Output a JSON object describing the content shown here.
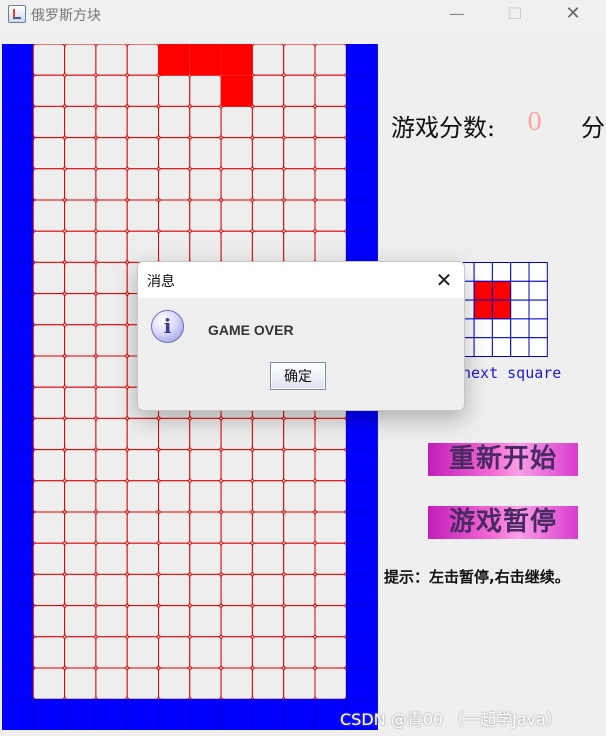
{
  "window": {
    "title": "俄罗斯方块",
    "minimize_glyph": "—",
    "maximize_glyph": "☐",
    "close_glyph": "✕"
  },
  "colors": {
    "wall": "#0000ff",
    "cell_border": "#e00000",
    "cell_bg": "#eeeeee",
    "block": "#ff0000",
    "preview_border": "#0000cc"
  },
  "board": {
    "rows": 21,
    "cols": 12,
    "wall_cols": [
      0,
      11
    ],
    "floor_row": 21,
    "filled": [
      [
        0,
        5
      ],
      [
        0,
        6
      ],
      [
        0,
        7
      ],
      [
        1,
        7
      ]
    ]
  },
  "score": {
    "label": "游戏分数:",
    "value": "0",
    "unit": "分"
  },
  "next": {
    "grid_rows": 5,
    "grid_cols": 6,
    "filled": [
      [
        1,
        2
      ],
      [
        1,
        3
      ],
      [
        2,
        2
      ],
      [
        2,
        3
      ]
    ],
    "label": "next square"
  },
  "buttons": {
    "restart": "重新开始",
    "pause": "游戏暂停"
  },
  "hint": "提示：左击暂停,右击继续。",
  "dialog": {
    "title": "消息",
    "close_glyph": "✕",
    "icon_glyph": "i",
    "message": "GAME OVER",
    "ok_label": "确定"
  },
  "watermark": "CSDN @青00 （一起学Java）"
}
